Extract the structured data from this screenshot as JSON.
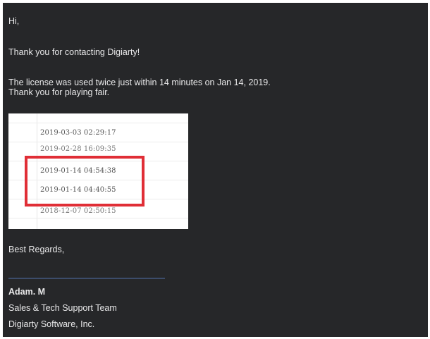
{
  "email": {
    "greeting": "Hi,",
    "thanks": "Thank you for contacting Digiarty!",
    "body_line_1": "The license was used twice just within 14 minutes on Jan 14, 2019.",
    "body_line_2": "Thank you for playing fair."
  },
  "screenshot": {
    "timestamps": [
      "2019-03-03 02:29:17",
      "2019-02-28 16:09:35",
      "2019-01-14 04:54:38",
      "2019-01-14 04:40:55",
      "2018-12-07 02:50:15"
    ],
    "highlight_color": "#e02e36"
  },
  "closing": {
    "regards": "Best Regards,"
  },
  "signature": {
    "name": "Adam. M",
    "team": "Sales & Tech Support Team",
    "company": "Digiarty Software, Inc."
  }
}
